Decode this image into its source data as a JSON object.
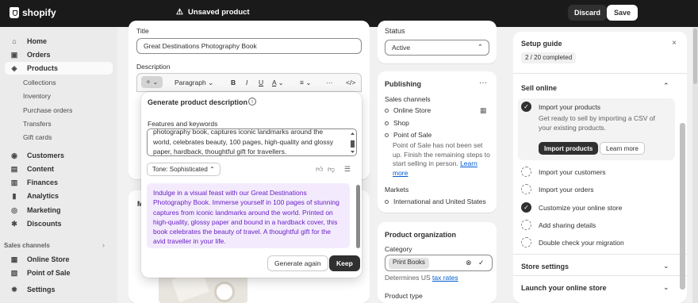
{
  "topbar": {
    "brand": "shopify",
    "status": "Unsaved product",
    "discard": "Discard",
    "save": "Save"
  },
  "sidebar": {
    "items": [
      {
        "label": "Home",
        "icon": "⌂"
      },
      {
        "label": "Orders",
        "icon": "▣"
      },
      {
        "label": "Products",
        "icon": "◈"
      },
      {
        "label": "Customers",
        "icon": "◉"
      },
      {
        "label": "Content",
        "icon": "▤"
      },
      {
        "label": "Finances",
        "icon": "▥"
      },
      {
        "label": "Analytics",
        "icon": "▮"
      },
      {
        "label": "Marketing",
        "icon": "◎"
      },
      {
        "label": "Discounts",
        "icon": "✱"
      }
    ],
    "product_subitems": [
      "Collections",
      "Inventory",
      "Purchase orders",
      "Transfers",
      "Gift cards"
    ],
    "sales_channels_label": "Sales channels",
    "channels": [
      {
        "label": "Online Store",
        "icon": "▦"
      },
      {
        "label": "Point of Sale",
        "icon": "▧"
      }
    ],
    "settings": {
      "label": "Settings",
      "icon": "✹"
    }
  },
  "product": {
    "title_label": "Title",
    "title_value": "Great Destinations Photography Book",
    "description_label": "Description",
    "toolbar": {
      "paragraph": "Paragraph",
      "bold": "B",
      "italic": "I",
      "underline": "U",
      "color": "A",
      "align": "≡",
      "more": "···",
      "code": "</>"
    }
  },
  "generator": {
    "title": "Generate product description",
    "keywords_label": "Features and keywords",
    "keywords_text": "photography book, captures iconic landmarks around the world, celebrates beauty, 100 pages, high-quality and glossy paper, hardback, thoughtful gift for travellers.",
    "tone": "Tone: Sophisticated",
    "generated": "Indulge in a visual feast with our Great Destinations Photography Book. Immerse yourself in 100 pages of stunning captures from iconic landmarks around the world. Printed on high-quality, glossy paper and bound in a hardback cover, this book celebrates the beauty of travel. A thoughtful gift for the avid traveller in your life.",
    "regenerate": "Generate again",
    "keep": "Keep"
  },
  "status": {
    "label": "Status",
    "value": "Active"
  },
  "publishing": {
    "title": "Publishing",
    "sales_channels": "Sales channels",
    "channels": [
      "Online Store",
      "Shop",
      "Point of Sale"
    ],
    "pos_note": "Point of Sale has not been set up. Finish the remaining steps to start selling in person.",
    "learn_more": "Learn more",
    "markets": "Markets",
    "market_value": "International and United States"
  },
  "organization": {
    "title": "Product organization",
    "category_label": "Category",
    "category_value": "Print Books",
    "determines": "Determines US",
    "tax_rates": "tax rates",
    "product_type": "Product type"
  },
  "guide": {
    "title": "Setup guide",
    "progress": "2 / 20 completed",
    "section": "Sell online",
    "step_active": "Import your products",
    "step_desc": "Get ready to sell by importing a CSV of your existing products.",
    "import_btn": "Import products",
    "learn_btn": "Learn more",
    "steps": [
      {
        "label": "Import your customers",
        "done": false
      },
      {
        "label": "Import your orders",
        "done": false
      },
      {
        "label": "Customize your online store",
        "done": true
      },
      {
        "label": "Add sharing details",
        "done": false
      },
      {
        "label": "Double check your migration",
        "done": false
      }
    ],
    "store_settings": "Store settings",
    "launch": "Launch your online store"
  }
}
